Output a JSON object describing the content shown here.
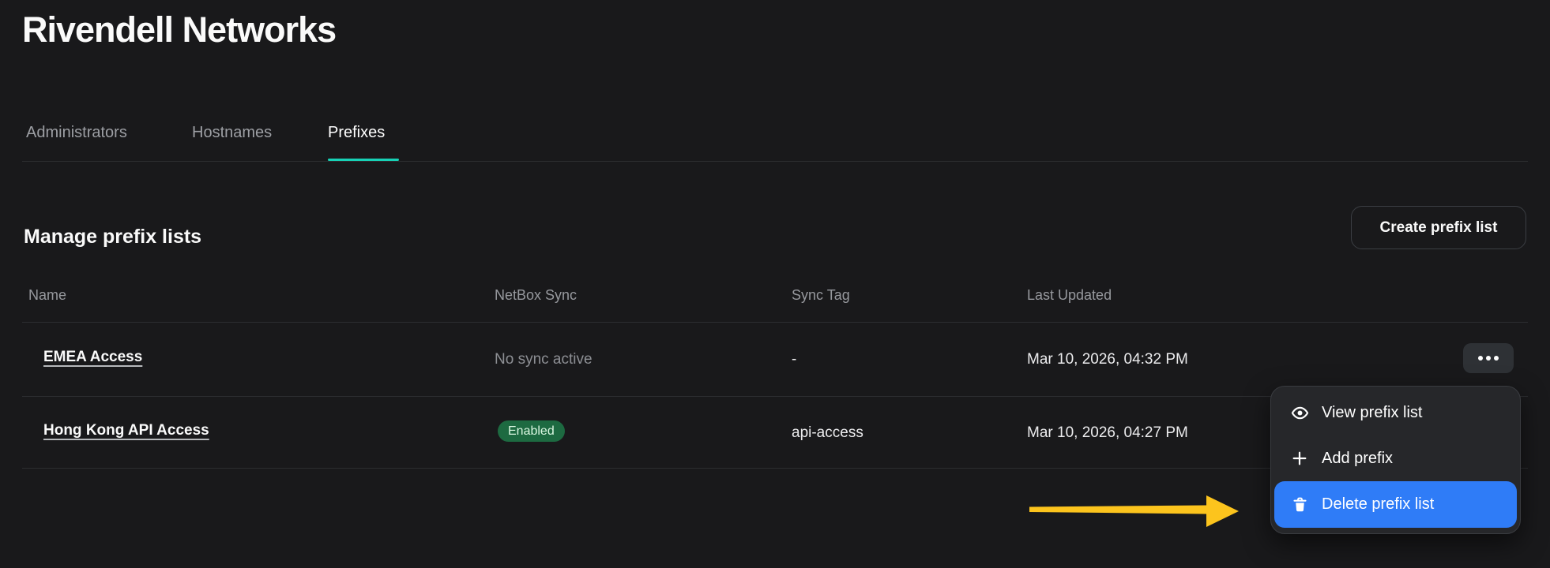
{
  "app": {
    "title": "Rivendell Networks"
  },
  "tabs": {
    "items": [
      {
        "label": "Administrators",
        "active": false
      },
      {
        "label": "Hostnames",
        "active": false
      },
      {
        "label": "Prefixes",
        "active": true
      }
    ]
  },
  "section": {
    "heading": "Manage prefix lists",
    "create_button_label": "Create prefix list"
  },
  "table": {
    "headers": {
      "name": "Name",
      "netbox_sync": "NetBox Sync",
      "sync_tag": "Sync Tag",
      "last_updated": "Last Updated"
    },
    "rows": [
      {
        "name": "EMEA Access",
        "netbox_sync": "No sync active",
        "sync_tag": "-",
        "last_updated": "Mar 10, 2026, 04:32 PM"
      },
      {
        "name": "Hong Kong API Access",
        "netbox_sync_badge": "Enabled",
        "sync_tag": "api-access",
        "last_updated": "Mar 10, 2026, 04:27 PM"
      }
    ]
  },
  "context_menu": {
    "items": [
      {
        "label": "View prefix list",
        "icon": "eye-icon",
        "highlighted": false
      },
      {
        "label": "Add prefix",
        "icon": "plus-icon",
        "highlighted": false
      },
      {
        "label": "Delete prefix list",
        "icon": "trash-icon",
        "highlighted": true
      }
    ]
  },
  "annotation": {
    "type": "arrow",
    "color": "#fcc41d"
  },
  "colors": {
    "background": "#19191b",
    "active_tab_underline": "#17d1b6",
    "badge_enabled_bg": "#1d6a41",
    "badge_enabled_text": "#daf7e1",
    "menu_highlight_blue": "#2f7cf7",
    "arrow_yellow": "#fcc41d"
  }
}
